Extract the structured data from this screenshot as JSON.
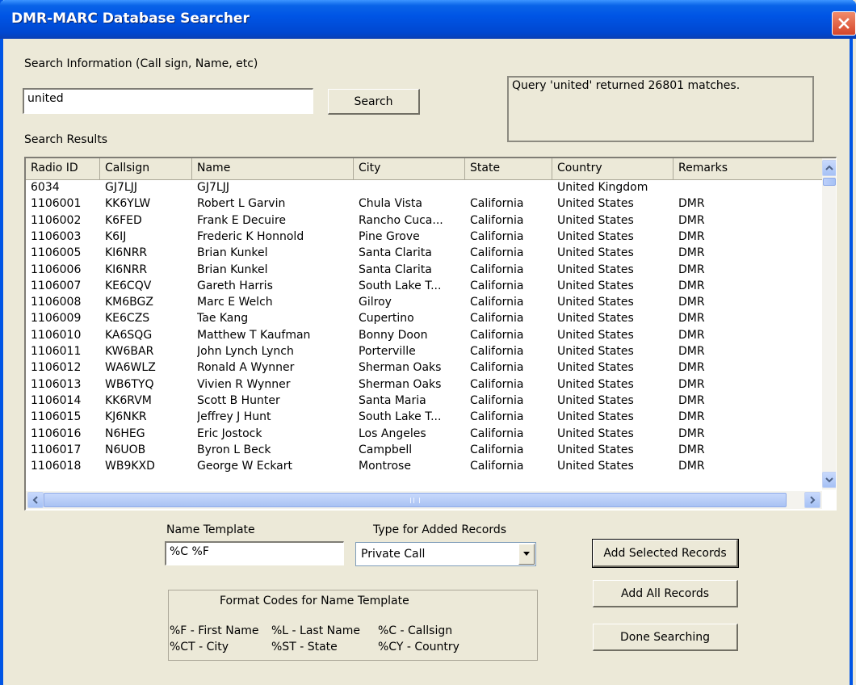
{
  "window": {
    "title": "DMR-MARC Database Searcher"
  },
  "search": {
    "label": "Search Information (Call sign, Name, etc)",
    "value": "united",
    "button": "Search",
    "status": "Query 'united' returned 26801 matches."
  },
  "results": {
    "label": "Search Results",
    "columns": [
      "Radio ID",
      "Callsign",
      "Name",
      "City",
      "State",
      "Country",
      "Remarks"
    ],
    "rows": [
      [
        "6034",
        "GJ7LJJ",
        "GJ7LJJ",
        "",
        "",
        "United Kingdom",
        ""
      ],
      [
        "1106001",
        "KK6YLW",
        "Robert L Garvin",
        "Chula Vista",
        "California",
        "United States",
        "DMR"
      ],
      [
        "1106002",
        "K6FED",
        "Frank E Decuire",
        "Rancho Cuca...",
        "California",
        "United States",
        "DMR"
      ],
      [
        "1106003",
        "K6IJ",
        "Frederic K Honnold",
        "Pine Grove",
        "California",
        "United States",
        "DMR"
      ],
      [
        "1106005",
        "KI6NRR",
        "Brian Kunkel",
        "Santa Clarita",
        "California",
        "United States",
        "DMR"
      ],
      [
        "1106006",
        "KI6NRR",
        "Brian Kunkel",
        "Santa Clarita",
        "California",
        "United States",
        "DMR"
      ],
      [
        "1106007",
        "KE6CQV",
        "Gareth Harris",
        "South Lake T...",
        "California",
        "United States",
        "DMR"
      ],
      [
        "1106008",
        "KM6BGZ",
        "Marc E Welch",
        "Gilroy",
        "California",
        "United States",
        "DMR"
      ],
      [
        "1106009",
        "KE6CZS",
        "Tae Kang",
        "Cupertino",
        "California",
        "United States",
        "DMR"
      ],
      [
        "1106010",
        "KA6SQG",
        "Matthew T Kaufman",
        "Bonny Doon",
        "California",
        "United States",
        "DMR"
      ],
      [
        "1106011",
        "KW6BAR",
        "John Lynch Lynch",
        "Porterville",
        "California",
        "United States",
        "DMR"
      ],
      [
        "1106012",
        "WA6WLZ",
        "Ronald A Wynner",
        "Sherman Oaks",
        "California",
        "United States",
        "DMR"
      ],
      [
        "1106013",
        "WB6TYQ",
        "Vivien R Wynner",
        "Sherman Oaks",
        "California",
        "United States",
        "DMR"
      ],
      [
        "1106014",
        "KK6RVM",
        "Scott B Hunter",
        "Santa Maria",
        "California",
        "United States",
        "DMR"
      ],
      [
        "1106015",
        "KJ6NKR",
        "Jeffrey J Hunt",
        "South Lake T...",
        "California",
        "United States",
        "DMR"
      ],
      [
        "1106016",
        "N6HEG",
        "Eric Jostock",
        "Los Angeles",
        "California",
        "United States",
        "DMR"
      ],
      [
        "1106017",
        "N6UOB",
        "Byron L Beck",
        "Campbell",
        "California",
        "United States",
        "DMR"
      ],
      [
        "1106018",
        "WB9KXD",
        "George W Eckart",
        "Montrose",
        "California",
        "United States",
        "DMR"
      ]
    ]
  },
  "template": {
    "label": "Name Template",
    "value": "%C %F",
    "type_label": "Type for Added Records",
    "type_value": "Private Call"
  },
  "buttons": {
    "add_selected": "Add Selected Records",
    "add_all": "Add All Records",
    "done": "Done Searching"
  },
  "format": {
    "title": "Format Codes for Name Template",
    "codes": [
      "%F - First Name",
      "%L - Last Name",
      "%C - Callsign",
      "%CT - City",
      "%ST - State",
      "%CY - Country"
    ]
  }
}
